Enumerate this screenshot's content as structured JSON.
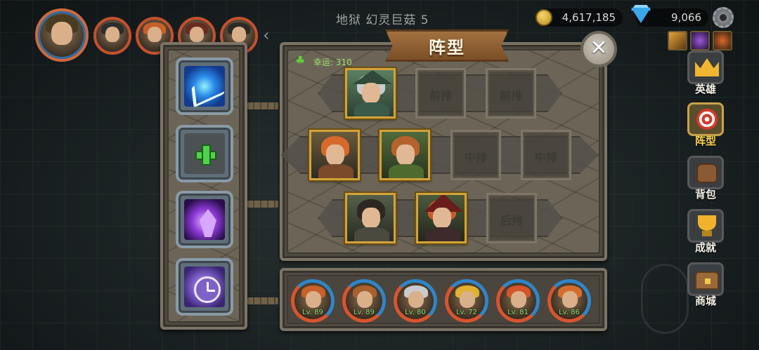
{
  "header": {
    "stage_title": "地狱 幻灵巨菇 5",
    "gold": "4,617,185",
    "gems": "9,066"
  },
  "party": {
    "avatars": [
      "main-hero-avatar",
      "hero-avatar-2",
      "hero-avatar-3",
      "hero-avatar-4",
      "hero-avatar-5"
    ]
  },
  "formation": {
    "title": "阵型",
    "close_label": "✕",
    "luck_label": "幸运: 310",
    "rows": {
      "front": {
        "slot_label": "前排"
      },
      "middle": {
        "slot_label": "中排"
      },
      "back": {
        "slot_label": "后排"
      }
    }
  },
  "skills": [
    "lightning-skill",
    "add-skill",
    "crystal-skill",
    "clock-skill"
  ],
  "roster": [
    {
      "level": "Lv. 89"
    },
    {
      "level": "Lv. 89"
    },
    {
      "level": "Lv. 80"
    },
    {
      "level": "Lv. 72"
    },
    {
      "level": "Lv. 81"
    },
    {
      "level": "Lv. 86"
    }
  ],
  "nav": {
    "heroes": "英雄",
    "formation": "阵型",
    "backpack": "背包",
    "achievements": "成就",
    "shop": "商城"
  },
  "colors": {
    "accent_gold": "#d2a33a",
    "active_nav": "#ffd54a",
    "luck_green": "#9fe36c",
    "level_green": "#8ee07a"
  }
}
